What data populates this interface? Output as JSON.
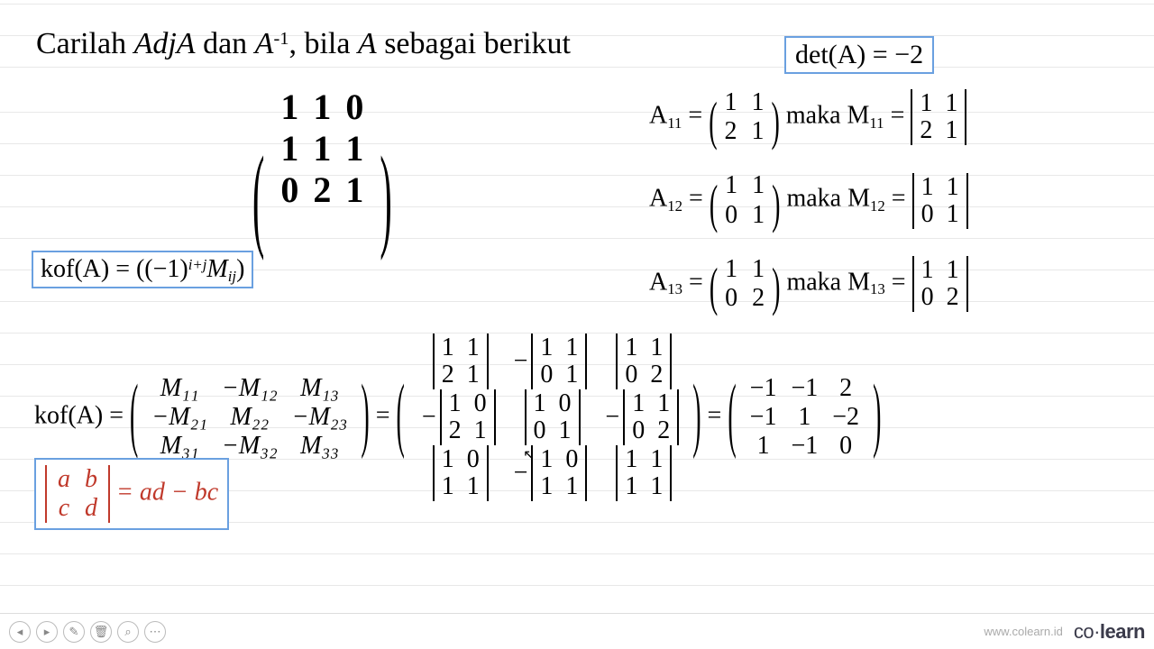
{
  "title_pre": "Carilah ",
  "title_adj": "AdjA",
  "title_mid1": " dan ",
  "title_ainv": "A",
  "title_ainv_sup": "-1",
  "title_mid2": ", bila ",
  "title_a": "A",
  "title_post": " sebagai berikut",
  "det_label": "det(A) = −2",
  "A": {
    "r1": [
      "1",
      "1",
      "0"
    ],
    "r2": [
      "1",
      "1",
      "1"
    ],
    "r3": [
      "0",
      "2",
      "1"
    ]
  },
  "kof_formula_pre": "kof(A) = ((−1)",
  "kof_formula_sup": "i+j",
  "kof_formula_post": "M",
  "kof_formula_sub": "ij",
  "kof_formula_end": ")",
  "minor_rows": [
    {
      "label": "A",
      "sub": "11",
      "eq": " = ",
      "m": [
        [
          "1",
          "1"
        ],
        [
          "2",
          "1"
        ]
      ],
      "word": "  maka M",
      "msub": "11",
      "d": [
        [
          "1",
          "1"
        ],
        [
          "2",
          "1"
        ]
      ]
    },
    {
      "label": "A",
      "sub": "12",
      "eq": " = ",
      "m": [
        [
          "1",
          "1"
        ],
        [
          "0",
          "1"
        ]
      ],
      "word": "  maka M",
      "msub": "12",
      "d": [
        [
          "1",
          "1"
        ],
        [
          "0",
          "1"
        ]
      ]
    },
    {
      "label": "A",
      "sub": "13",
      "eq": " = ",
      "m": [
        [
          "1",
          "1"
        ],
        [
          "0",
          "2"
        ]
      ],
      "word": "  maka M",
      "msub": "13",
      "d": [
        [
          "1",
          "1"
        ],
        [
          "0",
          "2"
        ]
      ]
    }
  ],
  "kofA_label": "kof(A) = ",
  "kof_minor_matrix": [
    [
      "M₁₁",
      "−M₁₂",
      "M₁₃"
    ],
    [
      "−M₂₁",
      "M₂₂",
      "−M₂₃"
    ],
    [
      "M₃₁",
      "−M₃₂",
      "M₃₃"
    ]
  ],
  "eq": " = ",
  "det_grid": [
    [
      {
        "neg": "",
        "m": [
          [
            "1",
            "1"
          ],
          [
            "2",
            "1"
          ]
        ]
      },
      {
        "neg": "−",
        "m": [
          [
            "1",
            "1"
          ],
          [
            "0",
            "1"
          ]
        ]
      },
      {
        "neg": "",
        "m": [
          [
            "1",
            "1"
          ],
          [
            "0",
            "2"
          ]
        ]
      }
    ],
    [
      {
        "neg": "−",
        "m": [
          [
            "1",
            "0"
          ],
          [
            "2",
            "1"
          ]
        ]
      },
      {
        "neg": "",
        "m": [
          [
            "1",
            "0"
          ],
          [
            "0",
            "1"
          ]
        ]
      },
      {
        "neg": "−",
        "m": [
          [
            "1",
            "1"
          ],
          [
            "0",
            "2"
          ]
        ]
      }
    ],
    [
      {
        "neg": "",
        "m": [
          [
            "1",
            "0"
          ],
          [
            "1",
            "1"
          ]
        ]
      },
      {
        "neg": "−",
        "m": [
          [
            "1",
            "0"
          ],
          [
            "1",
            "1"
          ]
        ]
      },
      {
        "neg": "",
        "m": [
          [
            "1",
            "1"
          ],
          [
            "1",
            "1"
          ]
        ]
      }
    ]
  ],
  "result": [
    [
      "−1",
      "−1",
      "2"
    ],
    [
      "−1",
      "1",
      "−2"
    ],
    [
      "1",
      "−1",
      "0"
    ]
  ],
  "adbc_lhs": [
    [
      "a",
      "b"
    ],
    [
      "c",
      "d"
    ]
  ],
  "adbc_rhs": " = ad − bc",
  "footer": {
    "url": "www.colearn.id",
    "brand_l": "co·",
    "brand_r": "learn"
  }
}
